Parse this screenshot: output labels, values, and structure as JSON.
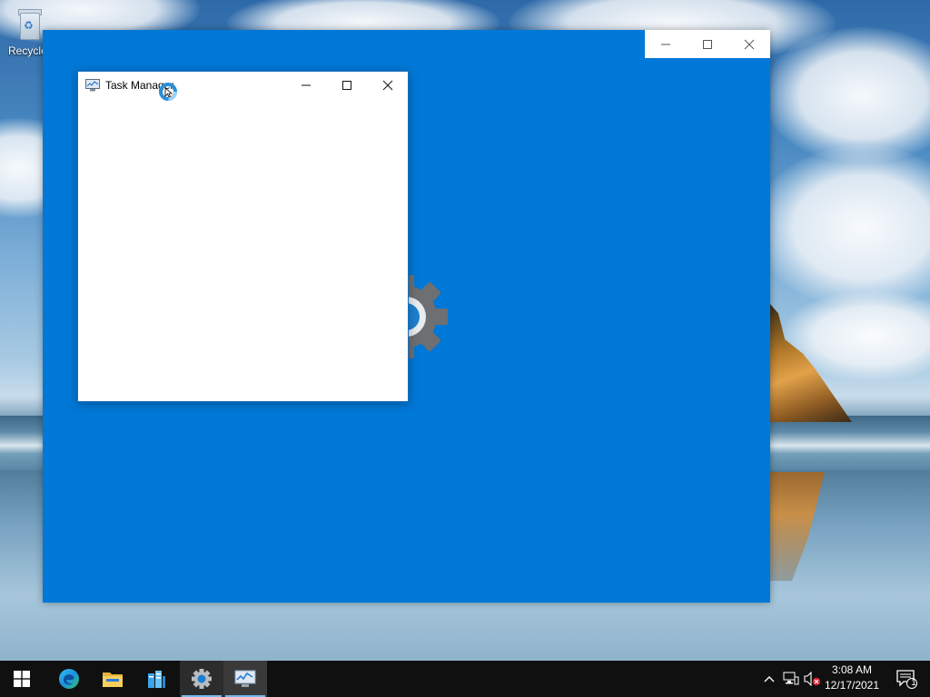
{
  "desktop": {
    "icons": [
      {
        "label": "Recycle Bin",
        "icon": "recycle-bin-icon"
      }
    ]
  },
  "settings_window": {
    "background": "#0078d7",
    "caption_buttons": [
      "minimize",
      "maximize",
      "close"
    ],
    "splash_icon": "gear-icon"
  },
  "task_manager_window": {
    "title": "Task Manager",
    "icon": "task-manager-icon",
    "caption_buttons": [
      "minimize",
      "maximize",
      "close"
    ],
    "cursor": "busy-cursor"
  },
  "taskbar": {
    "start_icon": "windows-logo-icon",
    "pinned": [
      {
        "name": "Microsoft Edge",
        "icon": "edge-icon",
        "running": false
      },
      {
        "name": "File Explorer",
        "icon": "folder-icon",
        "running": false
      },
      {
        "name": "Server Manager",
        "icon": "server-manager-icon",
        "running": false
      },
      {
        "name": "Settings",
        "icon": "gear-icon",
        "running": true
      },
      {
        "name": "Task Manager",
        "icon": "task-manager-icon",
        "running": true,
        "active": true
      }
    ],
    "tray": {
      "icons": [
        "chevron-up-icon",
        "network-icon",
        "volume-muted-icon"
      ],
      "time": "3:08 AM",
      "date": "12/17/2021",
      "notification_count": "1"
    }
  },
  "colors": {
    "accent": "#0078d7",
    "taskbar": "#101010",
    "running_indicator": "#76b9ed"
  }
}
